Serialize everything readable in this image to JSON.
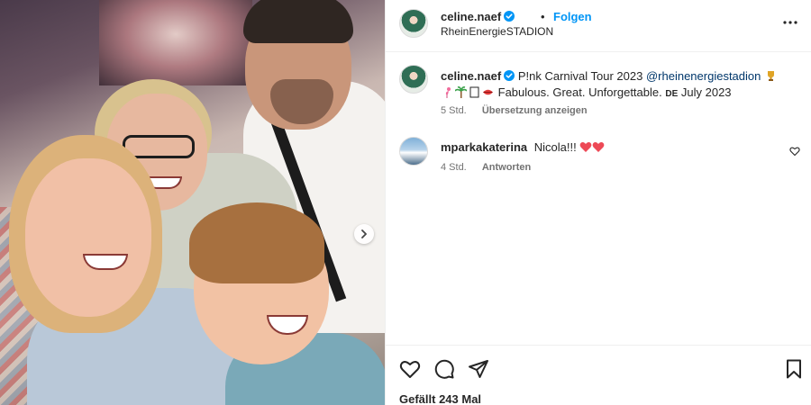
{
  "post": {
    "author": "celine.naef",
    "follow_label": "Folgen",
    "separator": "•",
    "location": "RheinEnergieSTADION",
    "caption": {
      "username": "celine.naef",
      "text_part1": "P!nk Carnival Tour 2023",
      "mention": "@rheinenergiestadion",
      "text_part2": "Fabulous. Great. Unforgettable.",
      "country_code": "DE",
      "text_part3": "July 2023",
      "time": "5 Std.",
      "translate_label": "Übersetzung anzeigen"
    },
    "comments": [
      {
        "username": "mparkakaterina",
        "text": "Nicola!!!",
        "time": "4 Std.",
        "reply_label": "Antworten"
      }
    ],
    "likes_text": "Gefällt 243 Mal"
  },
  "icons": {
    "more": "more-options-icon",
    "verified": "verified-badge-icon",
    "like": "heart-icon",
    "comment": "comment-bubble-icon",
    "share": "paper-plane-icon",
    "save": "bookmark-icon",
    "carousel": "chevron-right-icon"
  },
  "colors": {
    "follow_blue": "#0095f6",
    "verified_blue": "#0095f6",
    "mention": "#00376b",
    "meta_gray": "#737373",
    "heart_red": "#ed4956"
  }
}
